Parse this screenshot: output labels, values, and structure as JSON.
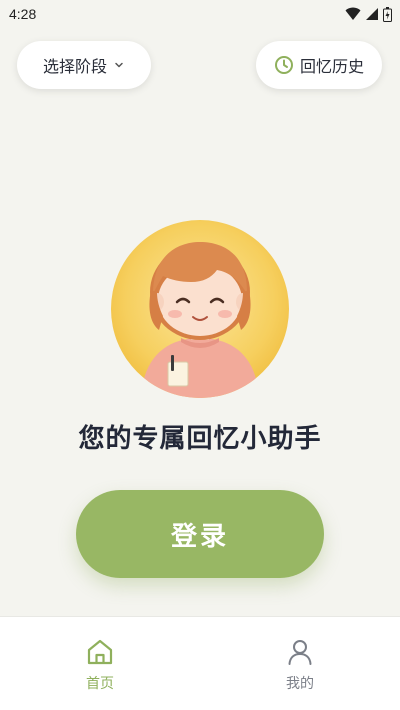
{
  "status_bar": {
    "time": "4:28"
  },
  "top_controls": {
    "stage_selector_label": "选择阶段",
    "history_label": "回忆历史"
  },
  "main": {
    "headline": "您的专属回忆小助手",
    "login_label": "登录"
  },
  "tab_bar": {
    "items": [
      {
        "label": "首页",
        "icon": "home-icon",
        "active": true
      },
      {
        "label": "我的",
        "icon": "person-icon",
        "active": false
      }
    ]
  },
  "colors": {
    "accent": "#98b764",
    "tab_active": "#8fb05c",
    "background": "#f4f4ef"
  }
}
